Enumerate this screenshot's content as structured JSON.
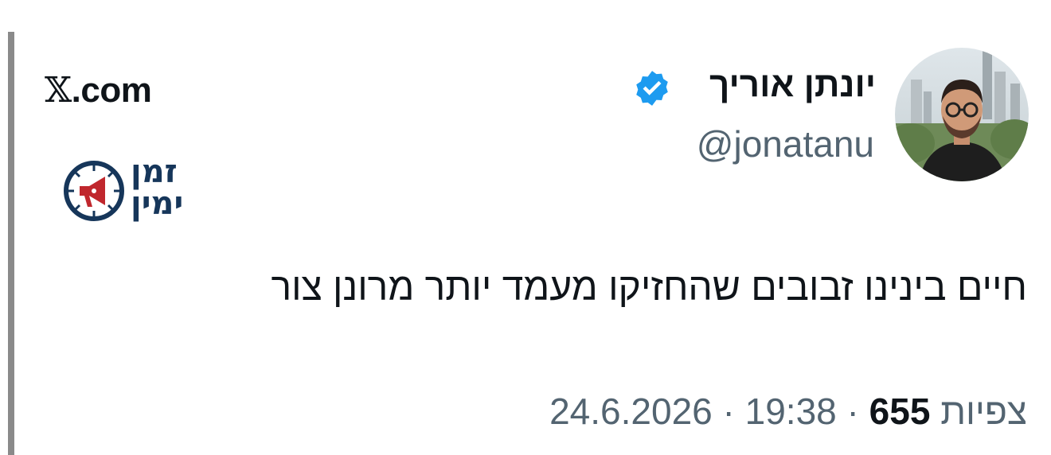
{
  "site": {
    "label": "X.com",
    "x_glyph": "𝕏",
    "suffix": ".com"
  },
  "brand_logo": {
    "line1": "זמן",
    "line2": "ימין",
    "icon": "megaphone-clock-icon",
    "color_text": "#16365a",
    "color_icon": "#c0272d"
  },
  "author": {
    "display_name": "יונתן אוריך",
    "handle": "@jonatanu",
    "verified": true,
    "verified_color": "#1d9bf0",
    "avatar": "avatar-photo"
  },
  "tweet": {
    "text": "חיים בינינו זבובים שהחזיקו מעמד יותר מרונן צור"
  },
  "meta": {
    "date": "24.6.2026",
    "time": "19:38",
    "separator": "·",
    "views_count": "655",
    "views_label": "צפיות"
  },
  "colors": {
    "primary_text": "#0f1419",
    "secondary_text": "#536471",
    "bar": "#8a8a8a"
  }
}
